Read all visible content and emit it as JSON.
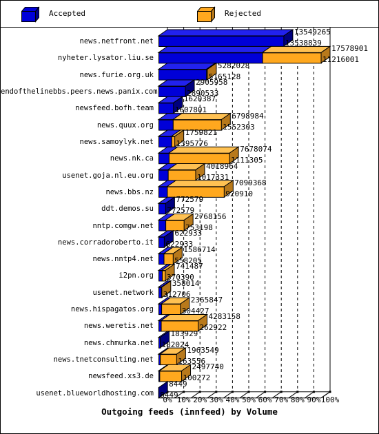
{
  "legend": {
    "items": [
      {
        "label": "Accepted",
        "color": "#0000D8",
        "icon": "cube-icon"
      },
      {
        "label": "Rejected",
        "color": "#FFA81E",
        "icon": "cube-icon"
      }
    ]
  },
  "chart_data": {
    "type": "bar",
    "orientation": "horizontal",
    "stacked": true,
    "title": "Outgoing feeds (innfeed) by Volume",
    "xlabel": "",
    "ylabel": "",
    "xlim": [
      0,
      100
    ],
    "xtick_labels": [
      "0%",
      "10%",
      "20%",
      "30%",
      "40%",
      "50%",
      "60%",
      "70%",
      "80%",
      "90%",
      "100%"
    ],
    "xtick_values": [
      0,
      10,
      20,
      30,
      40,
      50,
      60,
      70,
      80,
      90,
      100
    ],
    "grid": true,
    "legend_position": "top",
    "series": [
      {
        "name": "Accepted",
        "color": "#0000D8"
      },
      {
        "name": "Rejected",
        "color": "#FFA81E"
      }
    ],
    "categories": [
      "news.netfront.net",
      "nyheter.lysator.liu.se",
      "news.furie.org.uk",
      "endofthelinebbs.peers.news.panix.com",
      "newsfeed.bofh.team",
      "news.quux.org",
      "news.samoylyk.net",
      "news.nk.ca",
      "usenet.goja.nl.eu.org",
      "news.bbs.nz",
      "ddt.demos.su",
      "nntp.comgw.net",
      "news.corradoroberto.it",
      "news.nntp4.net",
      "i2pn.org",
      "usenet.network",
      "news.hispagatos.org",
      "news.weretis.net",
      "news.chmurka.net",
      "news.tnetconsulting.net",
      "newsfeed.xs3.de",
      "usenet.blueworldhosting.com"
    ],
    "rows": [
      {
        "feed": "news.netfront.net",
        "total": 13549265,
        "accepted": 13538839,
        "rejected": 10426
      },
      {
        "feed": "nyheter.lysator.liu.se",
        "total": 17578901,
        "accepted": 11216001,
        "rejected": 6362900
      },
      {
        "feed": "news.furie.org.uk",
        "total": 5282028,
        "accepted": 5165128,
        "rejected": 116900
      },
      {
        "feed": "endofthelinebbs.peers.news.panix.com",
        "total": 2905958,
        "accepted": 2890533,
        "rejected": 15425
      },
      {
        "feed": "newsfeed.bofh.team",
        "total": 1620387,
        "accepted": 1607801,
        "rejected": 12586
      },
      {
        "feed": "news.quux.org",
        "total": 6798984,
        "accepted": 1552303,
        "rejected": 5246681
      },
      {
        "feed": "news.samoylyk.net",
        "total": 1759821,
        "accepted": 1395776,
        "rejected": 364045
      },
      {
        "feed": "news.nk.ca",
        "total": 7678074,
        "accepted": 1111305,
        "rejected": 6566769
      },
      {
        "feed": "usenet.goja.nl.eu.org",
        "total": 4018964,
        "accepted": 1017331,
        "rejected": 3001633
      },
      {
        "feed": "news.bbs.nz",
        "total": 7099368,
        "accepted": 920910,
        "rejected": 6178458
      },
      {
        "feed": "ddt.demos.su",
        "total": 772579,
        "accepted": 772579,
        "rejected": 0
      },
      {
        "feed": "nntp.comgw.net",
        "total": 2768156,
        "accepted": 753198,
        "rejected": 2014958
      },
      {
        "feed": "news.corradoroberto.it",
        "total": 622933,
        "accepted": 622933,
        "rejected": 0
      },
      {
        "feed": "news.nntp4.net",
        "total": 1586714,
        "accepted": 558205,
        "rejected": 1028509
      },
      {
        "feed": "i2pn.org",
        "total": 741487,
        "accepted": 370390,
        "rejected": 371097
      },
      {
        "feed": "usenet.network",
        "total": 358014,
        "accepted": 312706,
        "rejected": 45308
      },
      {
        "feed": "news.hispagatos.org",
        "total": 2365847,
        "accepted": 304427,
        "rejected": 2061420
      },
      {
        "feed": "news.weretis.net",
        "total": 4283158,
        "accepted": 262922,
        "rejected": 4020236
      },
      {
        "feed": "news.chmurka.net",
        "total": 183929,
        "accepted": 182024,
        "rejected": 1905
      },
      {
        "feed": "news.tnetconsulting.net",
        "total": 1963549,
        "accepted": 163556,
        "rejected": 1799993
      },
      {
        "feed": "newsfeed.xs3.de",
        "total": 2497740,
        "accepted": 100272,
        "rejected": 2397468
      },
      {
        "feed": "usenet.blueworldhosting.com",
        "total": 8449,
        "accepted": 8449,
        "rejected": 0
      }
    ]
  }
}
